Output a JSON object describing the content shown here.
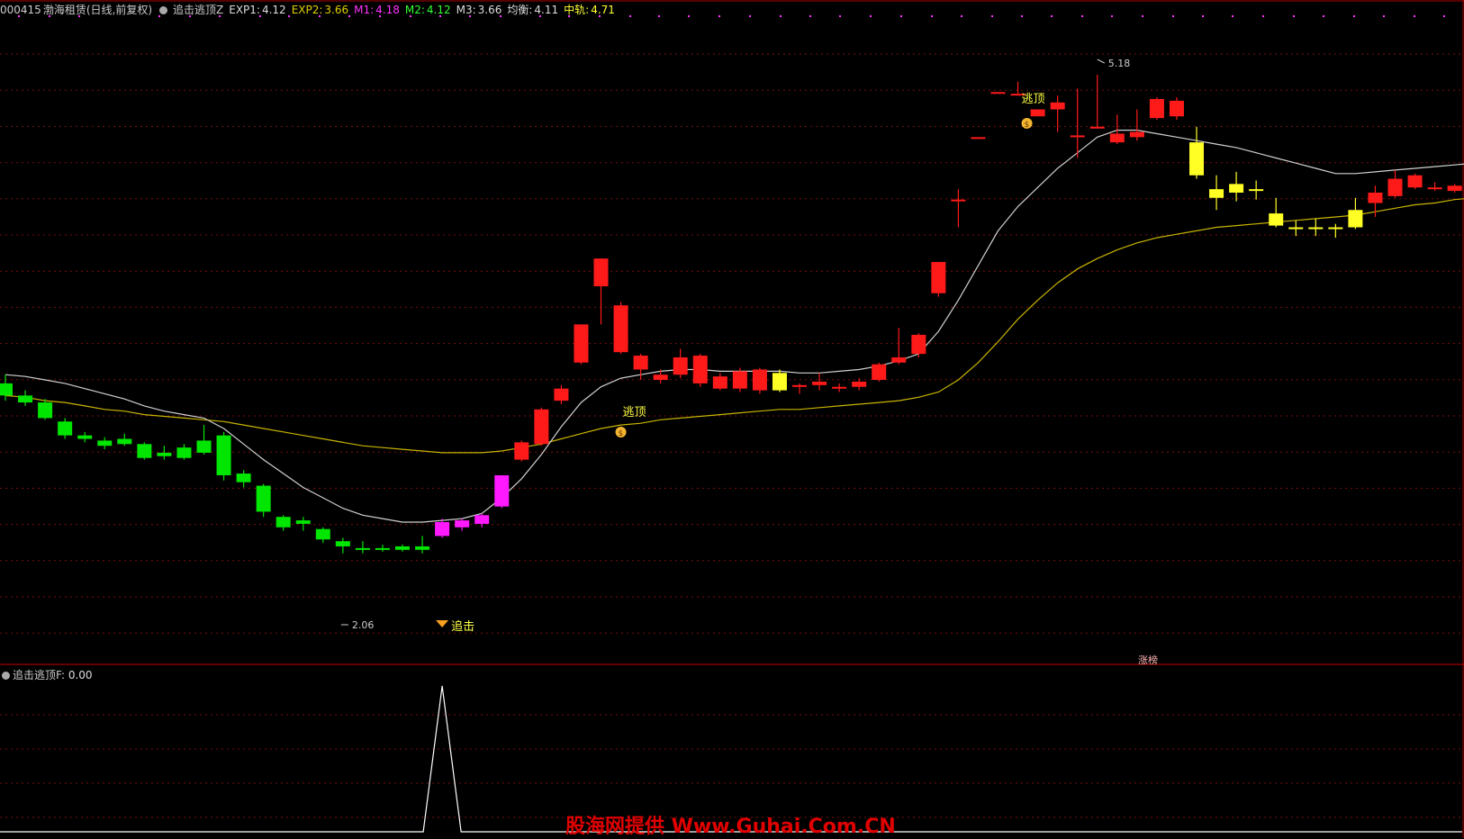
{
  "header": {
    "code": "000415",
    "name": "渤海租赁",
    "period": "(日线,前复权)",
    "indicator": "追击逃顶Z",
    "exp1_label": "EXP1:",
    "exp1_value": "4.12",
    "exp2_label": "EXP2:",
    "exp2_value": "3.66",
    "m1_label": "M1:",
    "m1_value": "4.18",
    "m2_label": "M2:",
    "m2_value": "4.12",
    "m3_label": "M3:",
    "m3_value": "3.66",
    "jh_label": "均衡:",
    "jh_value": "4.11",
    "zg_label": "中轨:",
    "zg_value": "4.71"
  },
  "sub": {
    "indicator": "追击逃顶F",
    "value_label": ": 0.00"
  },
  "annotations": {
    "escape1": "逃顶",
    "escape2": "逃顶",
    "chase": "追击",
    "low_price": "2.06",
    "high_price": "5.18",
    "tag": "涨榜"
  },
  "watermark": "股海网提供 Www.Guhai.Com.CN",
  "colors": {
    "bg": "#000000",
    "up": "#ff1a1a",
    "down": "#00e600",
    "chase_candle": "#ff19ff",
    "warn_candle": "#ffff26",
    "exp1_line": "#d0d0d0",
    "exp2_line": "#c8b400",
    "grid": "#7a1010",
    "sub_line": "#ffffff"
  },
  "chart_data": {
    "type": "candlestick",
    "price_range": [
      2.0,
      5.3
    ],
    "candles": [
      {
        "o": 3.4,
        "c": 3.33,
        "h": 3.45,
        "l": 3.3,
        "k": "down"
      },
      {
        "o": 3.33,
        "c": 3.29,
        "h": 3.36,
        "l": 3.27,
        "k": "down"
      },
      {
        "o": 3.29,
        "c": 3.2,
        "h": 3.31,
        "l": 3.19,
        "k": "down"
      },
      {
        "o": 3.18,
        "c": 3.1,
        "h": 3.2,
        "l": 3.08,
        "k": "down"
      },
      {
        "o": 3.1,
        "c": 3.08,
        "h": 3.12,
        "l": 3.06,
        "k": "down"
      },
      {
        "o": 3.07,
        "c": 3.04,
        "h": 3.09,
        "l": 3.02,
        "k": "down"
      },
      {
        "o": 3.08,
        "c": 3.05,
        "h": 3.11,
        "l": 3.04,
        "k": "down"
      },
      {
        "o": 3.05,
        "c": 2.97,
        "h": 3.06,
        "l": 2.96,
        "k": "down"
      },
      {
        "o": 3.0,
        "c": 2.98,
        "h": 3.04,
        "l": 2.96,
        "k": "down"
      },
      {
        "o": 2.97,
        "c": 3.03,
        "h": 3.05,
        "l": 2.96,
        "k": "down"
      },
      {
        "o": 3.0,
        "c": 3.07,
        "h": 3.16,
        "l": 2.99,
        "k": "down"
      },
      {
        "o": 3.1,
        "c": 2.87,
        "h": 3.12,
        "l": 2.84,
        "k": "down"
      },
      {
        "o": 2.88,
        "c": 2.83,
        "h": 2.9,
        "l": 2.8,
        "k": "down"
      },
      {
        "o": 2.81,
        "c": 2.66,
        "h": 2.82,
        "l": 2.63,
        "k": "down"
      },
      {
        "o": 2.63,
        "c": 2.57,
        "h": 2.64,
        "l": 2.55,
        "k": "down"
      },
      {
        "o": 2.61,
        "c": 2.59,
        "h": 2.63,
        "l": 2.55,
        "k": "down"
      },
      {
        "o": 2.56,
        "c": 2.5,
        "h": 2.57,
        "l": 2.48,
        "k": "down"
      },
      {
        "o": 2.49,
        "c": 2.46,
        "h": 2.51,
        "l": 2.42,
        "k": "down"
      },
      {
        "o": 2.45,
        "c": 2.44,
        "h": 2.49,
        "l": 2.42,
        "k": "down"
      },
      {
        "o": 2.45,
        "c": 2.45,
        "h": 2.47,
        "l": 2.43,
        "k": "down"
      },
      {
        "o": 2.46,
        "c": 2.44,
        "h": 2.47,
        "l": 2.43,
        "k": "down"
      },
      {
        "o": 2.44,
        "c": 2.46,
        "h": 2.52,
        "l": 2.42,
        "k": "down"
      },
      {
        "o": 2.52,
        "c": 2.6,
        "h": 2.62,
        "l": 2.51,
        "k": "chase"
      },
      {
        "o": 2.57,
        "c": 2.61,
        "h": 2.62,
        "l": 2.55,
        "k": "chase"
      },
      {
        "o": 2.59,
        "c": 2.64,
        "h": 2.65,
        "l": 2.57,
        "k": "chase"
      },
      {
        "o": 2.69,
        "c": 2.87,
        "h": 2.87,
        "l": 2.68,
        "k": "chase"
      },
      {
        "o": 2.96,
        "c": 3.06,
        "h": 3.07,
        "l": 2.95,
        "k": "up"
      },
      {
        "o": 3.05,
        "c": 3.25,
        "h": 3.26,
        "l": 3.04,
        "k": "up"
      },
      {
        "o": 3.3,
        "c": 3.37,
        "h": 3.39,
        "l": 3.28,
        "k": "up"
      },
      {
        "o": 3.52,
        "c": 3.74,
        "h": 3.74,
        "l": 3.51,
        "k": "up"
      },
      {
        "o": 3.96,
        "c": 4.12,
        "h": 4.12,
        "l": 3.74,
        "k": "up"
      },
      {
        "o": 3.58,
        "c": 3.85,
        "h": 3.87,
        "l": 3.57,
        "k": "up"
      },
      {
        "o": 3.48,
        "c": 3.56,
        "h": 3.57,
        "l": 3.42,
        "k": "up"
      },
      {
        "o": 3.42,
        "c": 3.45,
        "h": 3.48,
        "l": 3.4,
        "k": "up"
      },
      {
        "o": 3.45,
        "c": 3.55,
        "h": 3.6,
        "l": 3.43,
        "k": "up"
      },
      {
        "o": 3.4,
        "c": 3.56,
        "h": 3.57,
        "l": 3.38,
        "k": "up"
      },
      {
        "o": 3.37,
        "c": 3.44,
        "h": 3.46,
        "l": 3.36,
        "k": "up"
      },
      {
        "o": 3.37,
        "c": 3.47,
        "h": 3.49,
        "l": 3.35,
        "k": "up"
      },
      {
        "o": 3.36,
        "c": 3.48,
        "h": 3.49,
        "l": 3.34,
        "k": "up"
      },
      {
        "o": 3.36,
        "c": 3.46,
        "h": 3.48,
        "l": 3.35,
        "k": "warn"
      },
      {
        "o": 3.38,
        "c": 3.39,
        "h": 3.4,
        "l": 3.34,
        "k": "up"
      },
      {
        "o": 3.39,
        "c": 3.41,
        "h": 3.46,
        "l": 3.36,
        "k": "up"
      },
      {
        "o": 3.37,
        "c": 3.38,
        "h": 3.4,
        "l": 3.35,
        "k": "up"
      },
      {
        "o": 3.38,
        "c": 3.41,
        "h": 3.43,
        "l": 3.36,
        "k": "up"
      },
      {
        "o": 3.42,
        "c": 3.51,
        "h": 3.52,
        "l": 3.41,
        "k": "up"
      },
      {
        "o": 3.52,
        "c": 3.55,
        "h": 3.72,
        "l": 3.51,
        "k": "up"
      },
      {
        "o": 3.57,
        "c": 3.68,
        "h": 3.69,
        "l": 3.55,
        "k": "up"
      },
      {
        "o": 3.92,
        "c": 4.1,
        "h": 4.1,
        "l": 3.9,
        "k": "up"
      },
      {
        "o": 4.46,
        "c": 4.46,
        "h": 4.52,
        "l": 4.3,
        "k": "up"
      },
      {
        "o": 4.82,
        "c": 4.82,
        "h": 4.82,
        "l": 4.82,
        "k": "up"
      },
      {
        "o": 5.08,
        "c": 5.08,
        "h": 5.08,
        "l": 5.08,
        "k": "up"
      },
      {
        "o": 5.07,
        "c": 5.07,
        "h": 5.14,
        "l": 5.07,
        "k": "up"
      },
      {
        "o": 4.98,
        "c": 4.94,
        "h": 4.98,
        "l": 4.94,
        "k": "up"
      },
      {
        "o": 4.98,
        "c": 5.02,
        "h": 5.06,
        "l": 4.85,
        "k": "up"
      },
      {
        "o": 4.83,
        "c": 4.82,
        "h": 5.1,
        "l": 4.7,
        "k": "up"
      },
      {
        "o": 4.88,
        "c": 4.87,
        "h": 5.18,
        "l": 4.87,
        "k": "up"
      },
      {
        "o": 4.79,
        "c": 4.84,
        "h": 4.95,
        "l": 4.78,
        "k": "up"
      },
      {
        "o": 4.82,
        "c": 4.85,
        "h": 4.98,
        "l": 4.8,
        "k": "up"
      },
      {
        "o": 4.93,
        "c": 5.04,
        "h": 5.05,
        "l": 4.92,
        "k": "up"
      },
      {
        "o": 4.94,
        "c": 5.03,
        "h": 5.05,
        "l": 4.92,
        "k": "up"
      },
      {
        "o": 4.79,
        "c": 4.6,
        "h": 4.88,
        "l": 4.58,
        "k": "warn"
      },
      {
        "o": 4.47,
        "c": 4.52,
        "h": 4.6,
        "l": 4.4,
        "k": "warn"
      },
      {
        "o": 4.5,
        "c": 4.55,
        "h": 4.62,
        "l": 4.45,
        "k": "warn"
      },
      {
        "o": 4.52,
        "c": 4.52,
        "h": 4.57,
        "l": 4.46,
        "k": "warn"
      },
      {
        "o": 4.38,
        "c": 4.31,
        "h": 4.47,
        "l": 4.3,
        "k": "warn"
      },
      {
        "o": 4.3,
        "c": 4.3,
        "h": 4.34,
        "l": 4.25,
        "k": "warn"
      },
      {
        "o": 4.3,
        "c": 4.3,
        "h": 4.35,
        "l": 4.25,
        "k": "warn"
      },
      {
        "o": 4.3,
        "c": 4.3,
        "h": 4.32,
        "l": 4.24,
        "k": "warn"
      },
      {
        "o": 4.3,
        "c": 4.4,
        "h": 4.47,
        "l": 4.29,
        "k": "warn"
      },
      {
        "o": 4.44,
        "c": 4.5,
        "h": 4.54,
        "l": 4.36,
        "k": "up"
      },
      {
        "o": 4.48,
        "c": 4.58,
        "h": 4.63,
        "l": 4.47,
        "k": "up"
      },
      {
        "o": 4.53,
        "c": 4.6,
        "h": 4.61,
        "l": 4.52,
        "k": "up"
      },
      {
        "o": 4.52,
        "c": 4.53,
        "h": 4.56,
        "l": 4.51,
        "k": "up"
      },
      {
        "o": 4.51,
        "c": 4.54,
        "h": 4.55,
        "l": 4.5,
        "k": "up"
      },
      {
        "o": 4.5,
        "c": 4.62,
        "h": 4.63,
        "l": 4.49,
        "k": "up"
      }
    ],
    "exp1": [
      3.45,
      3.44,
      3.42,
      3.4,
      3.37,
      3.34,
      3.31,
      3.27,
      3.24,
      3.22,
      3.2,
      3.14,
      3.05,
      2.96,
      2.88,
      2.8,
      2.74,
      2.68,
      2.64,
      2.62,
      2.6,
      2.6,
      2.61,
      2.62,
      2.65,
      2.74,
      2.85,
      2.99,
      3.15,
      3.29,
      3.38,
      3.43,
      3.45,
      3.47,
      3.48,
      3.48,
      3.47,
      3.47,
      3.47,
      3.47,
      3.46,
      3.46,
      3.47,
      3.48,
      3.5,
      3.53,
      3.57,
      3.7,
      3.88,
      4.08,
      4.28,
      4.42,
      4.53,
      4.64,
      4.73,
      4.82,
      4.86,
      4.86,
      4.84,
      4.82,
      4.8,
      4.78,
      4.76,
      4.73,
      4.7,
      4.67,
      4.64,
      4.61,
      4.61,
      4.62,
      4.63,
      4.64,
      4.65,
      4.66,
      4.67
    ],
    "exp2": [
      3.33,
      3.32,
      3.3,
      3.29,
      3.27,
      3.25,
      3.24,
      3.22,
      3.21,
      3.2,
      3.19,
      3.18,
      3.16,
      3.14,
      3.12,
      3.1,
      3.08,
      3.06,
      3.04,
      3.03,
      3.02,
      3.01,
      3.0,
      3.0,
      3.0,
      3.01,
      3.03,
      3.05,
      3.08,
      3.11,
      3.14,
      3.16,
      3.17,
      3.19,
      3.2,
      3.21,
      3.22,
      3.23,
      3.24,
      3.25,
      3.25,
      3.26,
      3.27,
      3.28,
      3.29,
      3.3,
      3.32,
      3.35,
      3.42,
      3.52,
      3.64,
      3.77,
      3.88,
      3.98,
      4.06,
      4.12,
      4.17,
      4.21,
      4.24,
      4.26,
      4.28,
      4.3,
      4.31,
      4.32,
      4.33,
      4.34,
      4.35,
      4.36,
      4.37,
      4.39,
      4.41,
      4.43,
      4.44,
      4.46,
      4.47
    ],
    "sub_series": {
      "name": "追击逃顶F",
      "peak_index": 22,
      "values_note": "0 everywhere except a single spike at peak_index",
      "peak_value": 1
    }
  }
}
